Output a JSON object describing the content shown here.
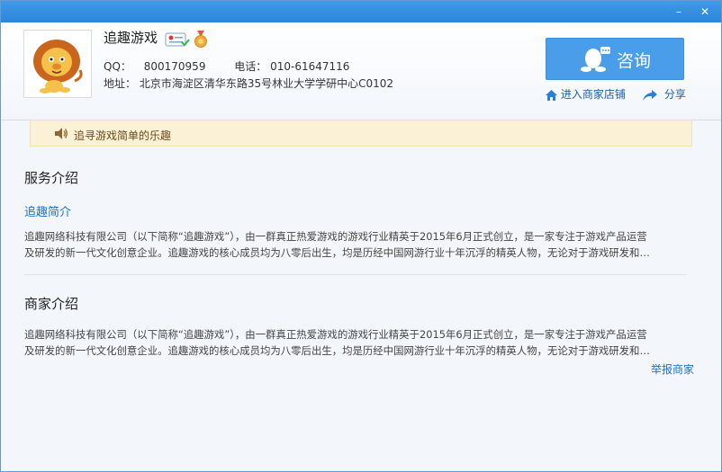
{
  "window": {
    "minimize_glyph": "–",
    "close_glyph": "✕"
  },
  "shop": {
    "name": "追趣游戏",
    "qq_label": "QQ：",
    "qq": "800170959",
    "phone_label": "电话：",
    "phone": "010-61647116",
    "address_label": "地址：",
    "address": "北京市海淀区清华东路35号林业大学学研中心C0102",
    "logo_icon": "lion-mascot-icon",
    "cert_icon": "certified-badge-icon",
    "medal_icon": "medal-icon"
  },
  "actions": {
    "consult_label": "咨询",
    "store_link": "进入商家店铺",
    "share_link": "分享"
  },
  "notice": {
    "text": "追寻游戏简单的乐趣"
  },
  "service": {
    "title": "服务介绍",
    "subtitle": "追趣简介",
    "line1": "追趣网络科技有限公司（以下简称“追趣游戏”），由一群真正热爱游戏的游戏行业精英于2015年6月正式创立，是一家专注于游戏产品运营",
    "line2": "及研发的新一代文化创意企业。追趣游戏的核心成员均为八零后出生，均是历经中国网游行业十年沉浮的精英人物，无论对于游戏研发和…"
  },
  "merchant": {
    "title": "商家介绍",
    "line1": "追趣网络科技有限公司（以下简称“追趣游戏”），由一群真正热爱游戏的游戏行业精英于2015年6月正式创立，是一家专注于游戏产品运营",
    "line2": "及研发的新一代文化创意企业。追趣游戏的核心成员均为八零后出生，均是历经中国网游行业十年沉浮的精英人物，无论对于游戏研发和…",
    "report_link": "举报商家"
  },
  "colors": {
    "titlebar": "#2c86da",
    "accent_button": "#4a9de8",
    "link": "#1b73c7",
    "notice_bg": "#fbf1d6"
  }
}
